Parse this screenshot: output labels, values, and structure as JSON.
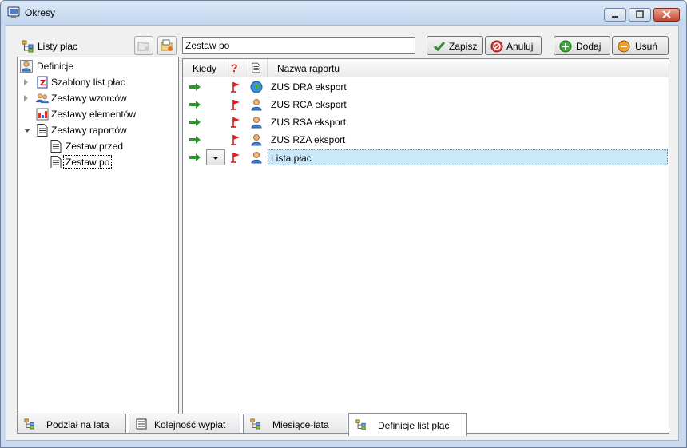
{
  "window": {
    "title": "Okresy",
    "icon": "app-icon"
  },
  "left_panel": {
    "title": "Listy płac",
    "tree": [
      {
        "label": "Definicje",
        "icon": "person-icon"
      },
      {
        "label": "Szablony list płac",
        "icon": "template-icon"
      },
      {
        "label": "Zestawy wzorców",
        "icon": "people-icon"
      },
      {
        "label": "Zestawy elementów",
        "icon": "elements-icon"
      },
      {
        "label": "Zestawy raportów",
        "icon": "document-icon"
      },
      {
        "label": "Zestaw przed",
        "icon": "document-icon"
      },
      {
        "label": "Zestaw po",
        "icon": "document-icon"
      }
    ]
  },
  "editor": {
    "name_value": "Zestaw po",
    "save_label": "Zapisz",
    "cancel_label": "Anuluj",
    "add_label": "Dodaj",
    "remove_label": "Usuń"
  },
  "grid": {
    "columns": {
      "when": "Kiedy",
      "question": "?",
      "report_name": "Nazwa raportu"
    },
    "rows": [
      {
        "name": "ZUS DRA eksport",
        "icon": "globe-icon"
      },
      {
        "name": "ZUS RCA eksport",
        "icon": "person-icon"
      },
      {
        "name": "ZUS RSA eksport",
        "icon": "person-icon"
      },
      {
        "name": "ZUS RZA eksport",
        "icon": "person-icon"
      },
      {
        "name": "Lista płac",
        "icon": "person-icon"
      }
    ]
  },
  "tabs": [
    {
      "label": "Podział na lata"
    },
    {
      "label": "Kolejność wypłat"
    },
    {
      "label": "Miesiące-lata"
    },
    {
      "label": "Definicje list płac",
      "active": true
    }
  ],
  "colors": {
    "accent": "#2e8b2e",
    "selection": "#c9e8fa",
    "flag": "#d81b1b"
  }
}
